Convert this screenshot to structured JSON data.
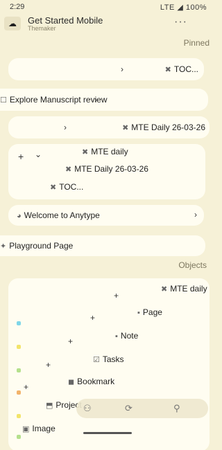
{
  "status_bar": {
    "time": "2:29",
    "indicators": "LTE ◢ 100%"
  },
  "header": {
    "avatar_glyph": "☁",
    "title": "Get Started Mobile",
    "subtitle": "Themaker",
    "more_glyph": "···"
  },
  "pinned": {
    "label": "Pinned",
    "items": [
      {
        "label": "TOC...",
        "icon": "✖"
      },
      {
        "label": "Explore Manuscript review",
        "icon": "☐"
      },
      {
        "label": "MTE Daily 26-03-26",
        "icon": "✖"
      }
    ],
    "group": {
      "title": "MTE daily",
      "title_icon": "✖",
      "children": [
        {
          "label": "MTE Daily 26-03-26",
          "icon": "✖"
        },
        {
          "label": "TOC...",
          "icon": "✖"
        }
      ],
      "add_glyph": "+",
      "expand_glyph": "⌄"
    },
    "extra": [
      {
        "label": "Welcome to Anytype",
        "icon": "◕"
      },
      {
        "label": "Playground Page",
        "icon": "✦"
      }
    ]
  },
  "objects": {
    "label": "Objects",
    "items": [
      {
        "label": "MTE daily",
        "icon": "✖",
        "color": "#ffffff"
      },
      {
        "label": "Page",
        "icon": "▪",
        "color": "#7fd6e8"
      },
      {
        "label": "Note",
        "icon": "▪",
        "color": "#f2e46a"
      },
      {
        "label": "Tasks",
        "icon": "☑",
        "color": "#b5e08c"
      },
      {
        "label": "Bookmark",
        "icon": "◼",
        "color": "#f2b36a"
      },
      {
        "label": "Project",
        "icon": "⬒",
        "color": "#f2e46a"
      },
      {
        "label": "Image",
        "icon": "▣",
        "color": "#b5e08c"
      }
    ],
    "add_glyph": "+"
  },
  "bottom_nav": {
    "people_glyph": "⚇",
    "chat_glyph": "⟳",
    "search_glyph": "⚲"
  }
}
